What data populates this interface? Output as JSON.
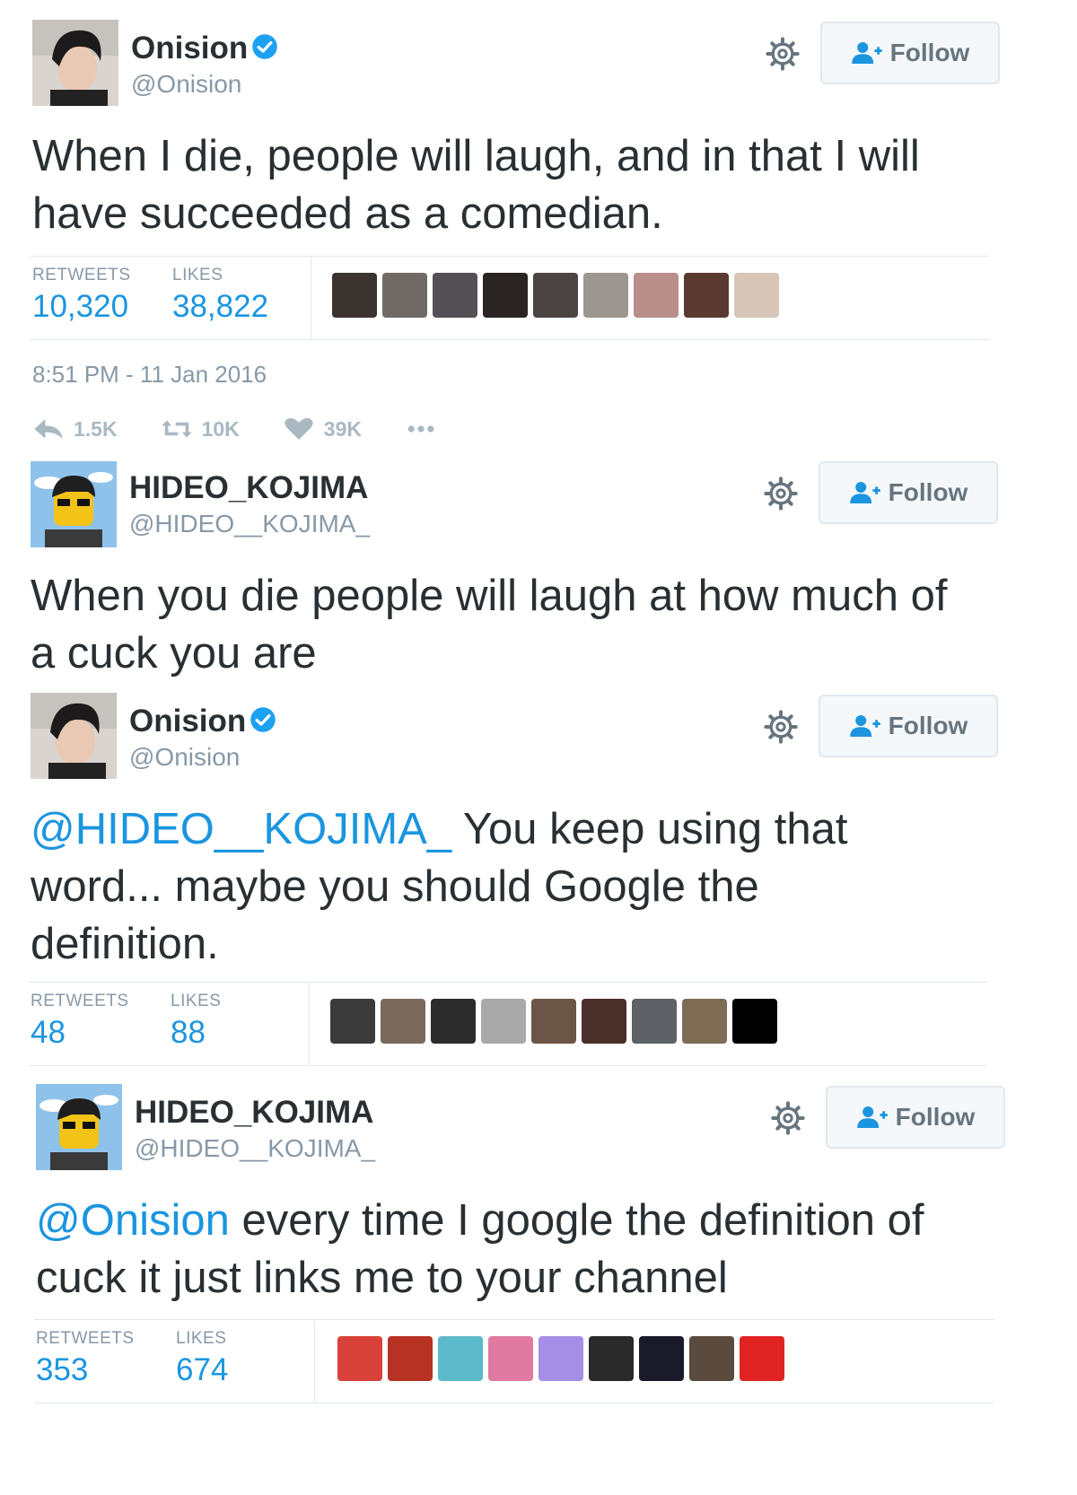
{
  "tweets": [
    {
      "name": "Onision",
      "verified": true,
      "handle": "@Onision",
      "follow_label": "Follow",
      "text_lines": [
        "When I die, people will laugh, and in that I will",
        "have succeeded as a comedian."
      ],
      "stats": {
        "retweets_label": "RETWEETS",
        "retweets": "10,320",
        "likes_label": "LIKES",
        "likes": "38,822"
      },
      "timestamp": "8:51 PM - 11 Jan 2016",
      "actions": {
        "reply_count": "1.5K",
        "retweet_count": "10K",
        "like_count": "39K"
      }
    },
    {
      "name": "HIDEO_KOJIMA",
      "verified": false,
      "handle": "@HIDEO__KOJIMA_",
      "follow_label": "Follow",
      "text_lines": [
        "When you die people will laugh at how much of",
        "a cuck you are"
      ]
    },
    {
      "name": "Onision",
      "verified": true,
      "handle": "@Onision",
      "follow_label": "Follow",
      "mention": "@HIDEO__KOJIMA_",
      "text_first_rest": " You keep using that",
      "text_lines_rest": [
        "word... maybe you should Google the",
        "definition."
      ],
      "stats": {
        "retweets_label": "RETWEETS",
        "retweets": "48",
        "likes_label": "LIKES",
        "likes": "88"
      }
    },
    {
      "name": "HIDEO_KOJIMA",
      "verified": false,
      "handle": "@HIDEO__KOJIMA_",
      "follow_label": "Follow",
      "mention": "@Onision",
      "text_first_rest": " every time I google the definition of",
      "text_lines_rest": [
        "cuck it just links me to your channel"
      ],
      "stats": {
        "retweets_label": "RETWEETS",
        "retweets": "353",
        "likes_label": "LIKES",
        "likes": "674"
      }
    }
  ],
  "colors": {
    "link_blue": "#1b95e0",
    "text_dark": "#292f33",
    "text_gray": "#8899a6",
    "verified_blue": "#1da1f2",
    "border": "#e1e8ed"
  }
}
